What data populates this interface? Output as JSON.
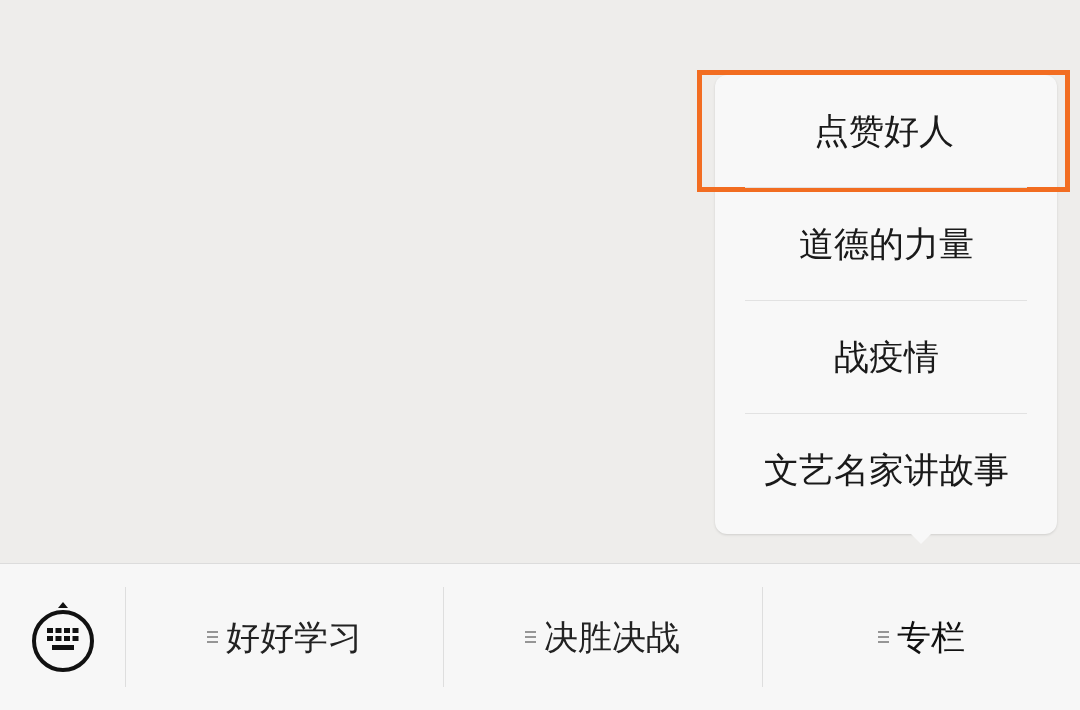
{
  "popup_menu": {
    "items": [
      {
        "label": "点赞好人",
        "highlighted": true
      },
      {
        "label": "道德的力量",
        "highlighted": false
      },
      {
        "label": "战疫情",
        "highlighted": false
      },
      {
        "label": "文艺名家讲故事",
        "highlighted": false
      }
    ]
  },
  "menu_bar": {
    "tabs": [
      {
        "label": "好好学习",
        "selected": false
      },
      {
        "label": "决胜决战",
        "selected": false
      },
      {
        "label": "专栏",
        "selected": true
      }
    ]
  }
}
